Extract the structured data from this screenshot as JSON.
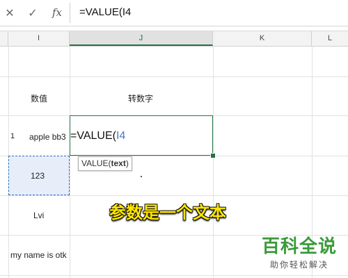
{
  "formula_bar": {
    "cancel_icon": "close-icon",
    "confirm_icon": "check-icon",
    "fx_label": "fx",
    "content": "=VALUE(I4"
  },
  "columns": {
    "I": "I",
    "J": "J",
    "K": "K",
    "L": "L"
  },
  "cells": {
    "I2": "数值",
    "J2": "转数字",
    "row4_num": "1",
    "I4": "apple bb3",
    "I5": "123",
    "I6": "Lvi",
    "I7": "my name is otk"
  },
  "edit": {
    "prefix": "=VALUE(",
    "ref": "I4"
  },
  "tooltip": {
    "func": "VALUE(",
    "arg": "text",
    "close": ")"
  },
  "annotation": "参数是一个文本",
  "watermark": {
    "title": "百科全说",
    "subtitle": "助你轻松解决"
  },
  "colors": {
    "accent": "#217346",
    "ref_blue": "#4a78c7",
    "annotation_yellow": "#ffe600",
    "watermark_green": "#3a9a3a"
  }
}
